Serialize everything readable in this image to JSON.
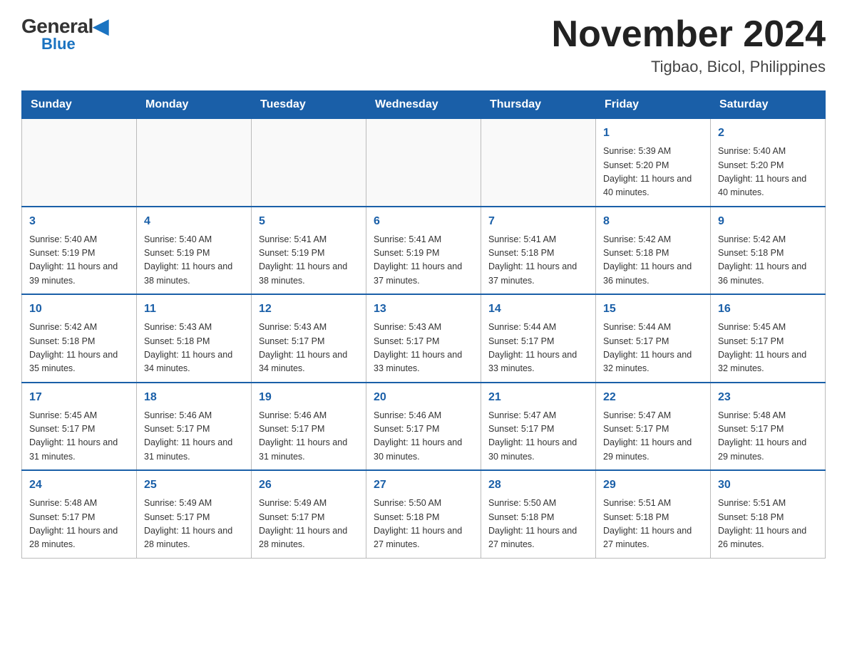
{
  "logo": {
    "general": "General",
    "blue": "Blue",
    "arrow_shape": "triangle"
  },
  "title": {
    "month_year": "November 2024",
    "location": "Tigbao, Bicol, Philippines"
  },
  "weekdays": [
    "Sunday",
    "Monday",
    "Tuesday",
    "Wednesday",
    "Thursday",
    "Friday",
    "Saturday"
  ],
  "weeks": [
    [
      {
        "day": "",
        "info": ""
      },
      {
        "day": "",
        "info": ""
      },
      {
        "day": "",
        "info": ""
      },
      {
        "day": "",
        "info": ""
      },
      {
        "day": "",
        "info": ""
      },
      {
        "day": "1",
        "info": "Sunrise: 5:39 AM\nSunset: 5:20 PM\nDaylight: 11 hours and 40 minutes."
      },
      {
        "day": "2",
        "info": "Sunrise: 5:40 AM\nSunset: 5:20 PM\nDaylight: 11 hours and 40 minutes."
      }
    ],
    [
      {
        "day": "3",
        "info": "Sunrise: 5:40 AM\nSunset: 5:19 PM\nDaylight: 11 hours and 39 minutes."
      },
      {
        "day": "4",
        "info": "Sunrise: 5:40 AM\nSunset: 5:19 PM\nDaylight: 11 hours and 38 minutes."
      },
      {
        "day": "5",
        "info": "Sunrise: 5:41 AM\nSunset: 5:19 PM\nDaylight: 11 hours and 38 minutes."
      },
      {
        "day": "6",
        "info": "Sunrise: 5:41 AM\nSunset: 5:19 PM\nDaylight: 11 hours and 37 minutes."
      },
      {
        "day": "7",
        "info": "Sunrise: 5:41 AM\nSunset: 5:18 PM\nDaylight: 11 hours and 37 minutes."
      },
      {
        "day": "8",
        "info": "Sunrise: 5:42 AM\nSunset: 5:18 PM\nDaylight: 11 hours and 36 minutes."
      },
      {
        "day": "9",
        "info": "Sunrise: 5:42 AM\nSunset: 5:18 PM\nDaylight: 11 hours and 36 minutes."
      }
    ],
    [
      {
        "day": "10",
        "info": "Sunrise: 5:42 AM\nSunset: 5:18 PM\nDaylight: 11 hours and 35 minutes."
      },
      {
        "day": "11",
        "info": "Sunrise: 5:43 AM\nSunset: 5:18 PM\nDaylight: 11 hours and 34 minutes."
      },
      {
        "day": "12",
        "info": "Sunrise: 5:43 AM\nSunset: 5:17 PM\nDaylight: 11 hours and 34 minutes."
      },
      {
        "day": "13",
        "info": "Sunrise: 5:43 AM\nSunset: 5:17 PM\nDaylight: 11 hours and 33 minutes."
      },
      {
        "day": "14",
        "info": "Sunrise: 5:44 AM\nSunset: 5:17 PM\nDaylight: 11 hours and 33 minutes."
      },
      {
        "day": "15",
        "info": "Sunrise: 5:44 AM\nSunset: 5:17 PM\nDaylight: 11 hours and 32 minutes."
      },
      {
        "day": "16",
        "info": "Sunrise: 5:45 AM\nSunset: 5:17 PM\nDaylight: 11 hours and 32 minutes."
      }
    ],
    [
      {
        "day": "17",
        "info": "Sunrise: 5:45 AM\nSunset: 5:17 PM\nDaylight: 11 hours and 31 minutes."
      },
      {
        "day": "18",
        "info": "Sunrise: 5:46 AM\nSunset: 5:17 PM\nDaylight: 11 hours and 31 minutes."
      },
      {
        "day": "19",
        "info": "Sunrise: 5:46 AM\nSunset: 5:17 PM\nDaylight: 11 hours and 31 minutes."
      },
      {
        "day": "20",
        "info": "Sunrise: 5:46 AM\nSunset: 5:17 PM\nDaylight: 11 hours and 30 minutes."
      },
      {
        "day": "21",
        "info": "Sunrise: 5:47 AM\nSunset: 5:17 PM\nDaylight: 11 hours and 30 minutes."
      },
      {
        "day": "22",
        "info": "Sunrise: 5:47 AM\nSunset: 5:17 PM\nDaylight: 11 hours and 29 minutes."
      },
      {
        "day": "23",
        "info": "Sunrise: 5:48 AM\nSunset: 5:17 PM\nDaylight: 11 hours and 29 minutes."
      }
    ],
    [
      {
        "day": "24",
        "info": "Sunrise: 5:48 AM\nSunset: 5:17 PM\nDaylight: 11 hours and 28 minutes."
      },
      {
        "day": "25",
        "info": "Sunrise: 5:49 AM\nSunset: 5:17 PM\nDaylight: 11 hours and 28 minutes."
      },
      {
        "day": "26",
        "info": "Sunrise: 5:49 AM\nSunset: 5:17 PM\nDaylight: 11 hours and 28 minutes."
      },
      {
        "day": "27",
        "info": "Sunrise: 5:50 AM\nSunset: 5:18 PM\nDaylight: 11 hours and 27 minutes."
      },
      {
        "day": "28",
        "info": "Sunrise: 5:50 AM\nSunset: 5:18 PM\nDaylight: 11 hours and 27 minutes."
      },
      {
        "day": "29",
        "info": "Sunrise: 5:51 AM\nSunset: 5:18 PM\nDaylight: 11 hours and 27 minutes."
      },
      {
        "day": "30",
        "info": "Sunrise: 5:51 AM\nSunset: 5:18 PM\nDaylight: 11 hours and 26 minutes."
      }
    ]
  ]
}
